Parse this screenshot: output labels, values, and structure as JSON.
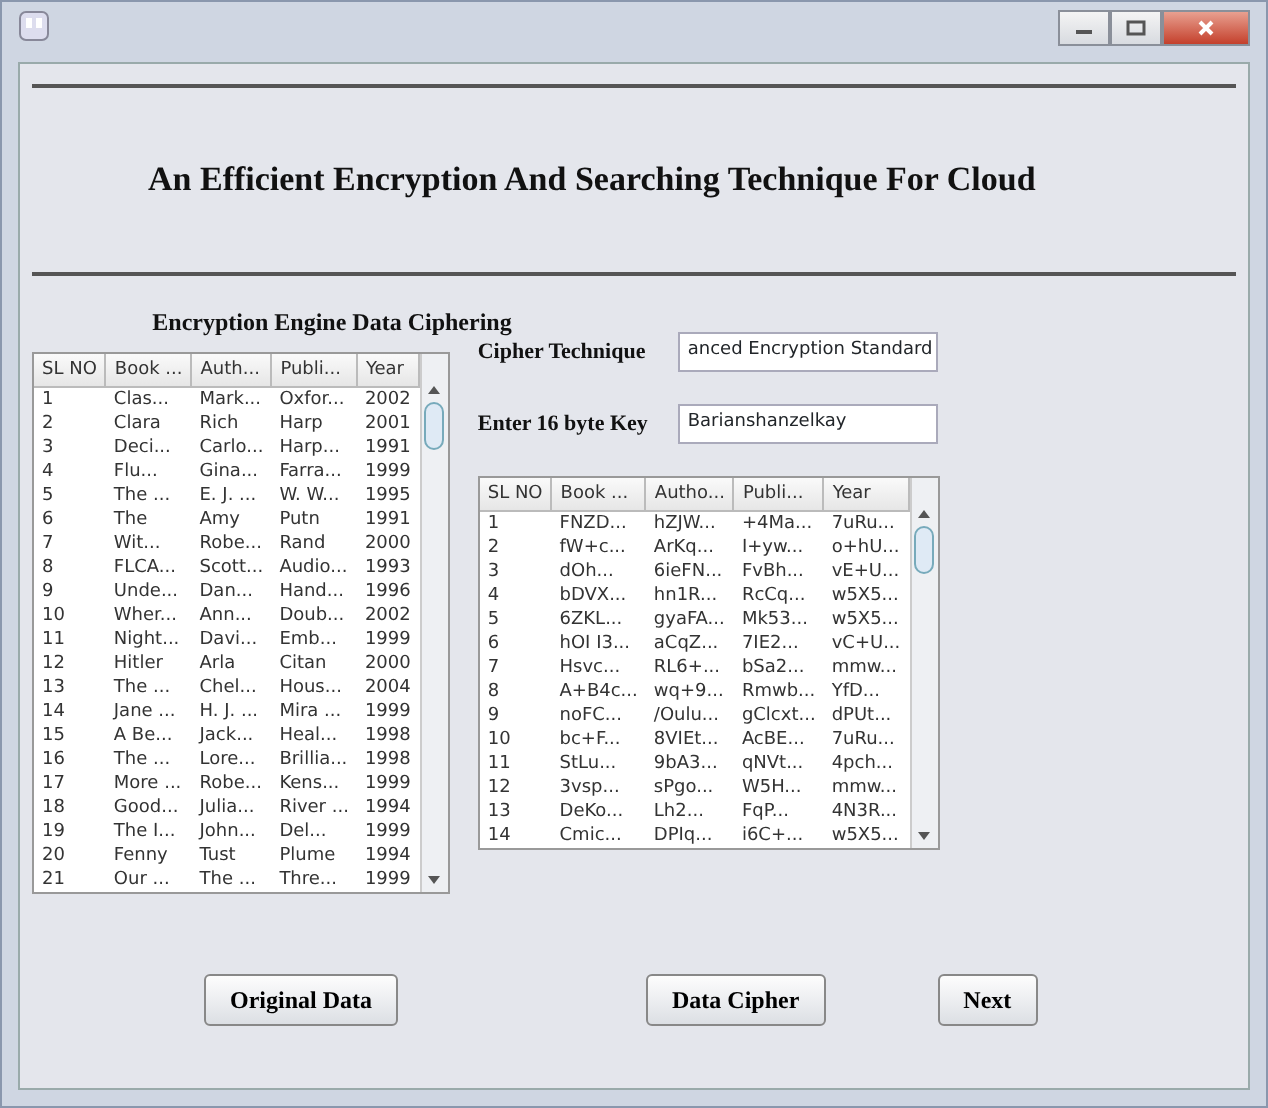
{
  "window": {
    "title_bar_buttons": [
      {
        "kind": "minimize"
      },
      {
        "kind": "maximize"
      },
      {
        "kind": "close"
      }
    ]
  },
  "header": {
    "title": "An Efficient Encryption And Searching Technique For Cloud"
  },
  "section_title": "Encryption Engine Data Ciphering",
  "original_table": {
    "columns": [
      "SL NO",
      "Book ...",
      "Auth...",
      "Publi...",
      "Year"
    ],
    "rows": [
      [
        "1",
        "Clas...",
        "Mark...",
        "Oxfor...",
        "2002"
      ],
      [
        "2",
        "Clara",
        "Rich",
        "Harp",
        "2001"
      ],
      [
        "3",
        "Deci...",
        "Carlo...",
        "Harp...",
        "1991"
      ],
      [
        "4",
        "Flu...",
        "Gina...",
        "Farra...",
        "1999"
      ],
      [
        "5",
        "The ...",
        "E. J. ...",
        "W. W...",
        "1995"
      ],
      [
        "6",
        "The",
        "Amy",
        "Putn",
        "1991"
      ],
      [
        "7",
        "Wit...",
        "Robe...",
        "Rand",
        "2000"
      ],
      [
        "8",
        "FLCA...",
        "Scott...",
        "Audio...",
        "1993"
      ],
      [
        "9",
        "Unde...",
        "Dan...",
        "Hand...",
        "1996"
      ],
      [
        "10",
        "Wher...",
        "Ann...",
        "Doub...",
        "2002"
      ],
      [
        "11",
        "Night...",
        "Davi...",
        "Emb...",
        "1999"
      ],
      [
        "12",
        "Hitler",
        "Arla",
        "Citan",
        "2000"
      ],
      [
        "13",
        "The ...",
        "Chel...",
        "Hous...",
        "2004"
      ],
      [
        "14",
        "Jane ...",
        "H. J. ...",
        "Mira ...",
        "1999"
      ],
      [
        "15",
        "A Be...",
        "Jack...",
        "Heal...",
        "1998"
      ],
      [
        "16",
        "The ...",
        "Lore...",
        "Brillia...",
        "1998"
      ],
      [
        "17",
        "More ...",
        "Robe...",
        "Kens...",
        "1999"
      ],
      [
        "18",
        "Good...",
        "Julia...",
        "River ...",
        "1994"
      ],
      [
        "19",
        "The I...",
        "John...",
        "Del...",
        "1999"
      ],
      [
        "20",
        "Fenny",
        "Tust",
        "Plume",
        "1994"
      ],
      [
        "21",
        "Our ...",
        "The ...",
        "Thre...",
        "1999"
      ]
    ]
  },
  "cipher_form": {
    "fields": [
      {
        "label": "Cipher Technique",
        "value": "anced Encryption Standard"
      },
      {
        "label": "Enter 16 byte Key",
        "value": "Barianshanzelkay"
      }
    ]
  },
  "cipher_table": {
    "columns": [
      "SL NO",
      "Book ...",
      "Autho...",
      "Publi...",
      "Year"
    ],
    "rows": [
      [
        "1",
        "FNZD...",
        "hZJW...",
        "+4Ma...",
        "7uRu..."
      ],
      [
        "2",
        "fW+c...",
        "ArKq...",
        "I+yw...",
        "o+hU..."
      ],
      [
        "3",
        "dOh...",
        "6ieFN...",
        "FvBh...",
        "vE+U..."
      ],
      [
        "4",
        "bDVX...",
        "hn1R...",
        "RcCq...",
        "w5X5..."
      ],
      [
        "5",
        "6ZKL...",
        "gyaFA...",
        "Mk53...",
        "w5X5..."
      ],
      [
        "6",
        "hOI I3...",
        "aCqZ...",
        "7IE2...",
        "vC+U..."
      ],
      [
        "7",
        "Hsvc...",
        "RL6+...",
        "bSa2...",
        "mmw..."
      ],
      [
        "8",
        "A+B4c...",
        "wq+9...",
        "Rmwb...",
        "YfD..."
      ],
      [
        "9",
        "noFC...",
        "/Oulu...",
        "gClcxt...",
        "dPUt..."
      ],
      [
        "10",
        "bc+F...",
        "8VIEt...",
        "AcBE...",
        "7uRu..."
      ],
      [
        "11",
        "StLu...",
        "9bA3...",
        "qNVt...",
        "4pch..."
      ],
      [
        "12",
        "3vsp...",
        "sPgo...",
        "W5H...",
        "mmw..."
      ],
      [
        "13",
        "DeKo...",
        "Lh2...",
        "FqP...",
        "4N3R..."
      ],
      [
        "14",
        "Cmic...",
        "DPIq...",
        "i6C+...",
        "w5X5..."
      ]
    ]
  },
  "buttons": [
    {
      "label": "Original Data"
    },
    {
      "label": "Data Cipher"
    },
    {
      "label": "Next"
    }
  ]
}
